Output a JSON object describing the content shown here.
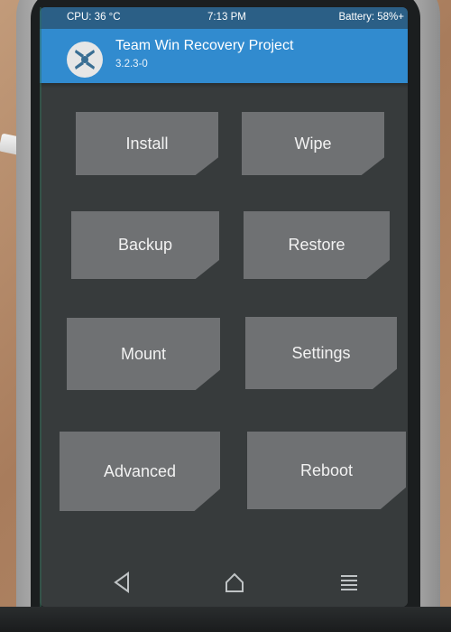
{
  "status_bar": {
    "cpu": "CPU: 36 °C",
    "time": "7:13 PM",
    "battery": "Battery: 58%+"
  },
  "header": {
    "title": "Team Win Recovery Project",
    "version": "3.2.3-0",
    "logo_icon": "twrp-logo-icon"
  },
  "menu": {
    "install": "Install",
    "wipe": "Wipe",
    "backup": "Backup",
    "restore": "Restore",
    "mount": "Mount",
    "settings": "Settings",
    "advanced": "Advanced",
    "reboot": "Reboot"
  },
  "nav": {
    "back_icon": "back-triangle-icon",
    "home_icon": "home-icon",
    "menu_icon": "hamburger-menu-icon"
  },
  "colors": {
    "status_bar": "#2b5f86",
    "header": "#318bcf",
    "screen_bg": "#373b3c",
    "tile": "#6f7173",
    "tile_text": "#f2f2f2"
  }
}
